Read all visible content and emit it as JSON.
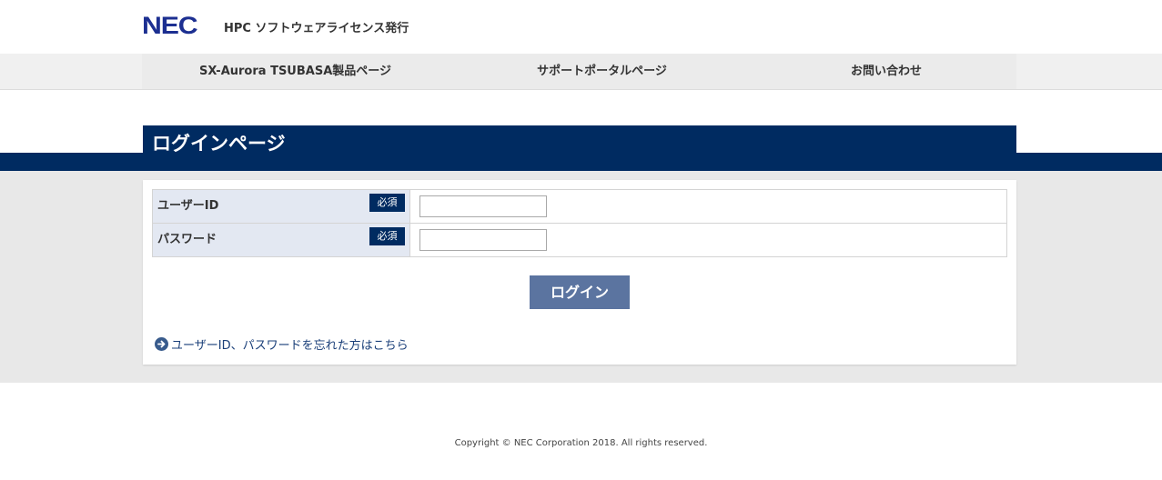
{
  "header": {
    "logo_text": "NEC",
    "site_title": "HPC ソフトウェアライセンス発行"
  },
  "nav": {
    "items": [
      {
        "label": "SX-Aurora TSUBASA製品ページ"
      },
      {
        "label": "サポートポータルページ"
      },
      {
        "label": "お問い合わせ"
      }
    ]
  },
  "page": {
    "title": "ログインページ"
  },
  "form": {
    "fields": [
      {
        "label": "ユーザーID",
        "required": "必須",
        "value": ""
      },
      {
        "label": "パスワード",
        "required": "必須",
        "value": ""
      }
    ],
    "submit_label": "ログイン",
    "forgot_link": "ユーザーID、パスワードを忘れた方はこちら",
    "forgot_icon": "arrow-right-circle-icon"
  },
  "footer": {
    "copyright": "Copyright © NEC Corporation 2018. All rights reserved."
  },
  "colors": {
    "brand_navy": "#002b61",
    "logo_blue": "#1c2f91",
    "button": "#5b74a0",
    "label_bg": "#e3e8f2",
    "link": "#1a3f79"
  }
}
